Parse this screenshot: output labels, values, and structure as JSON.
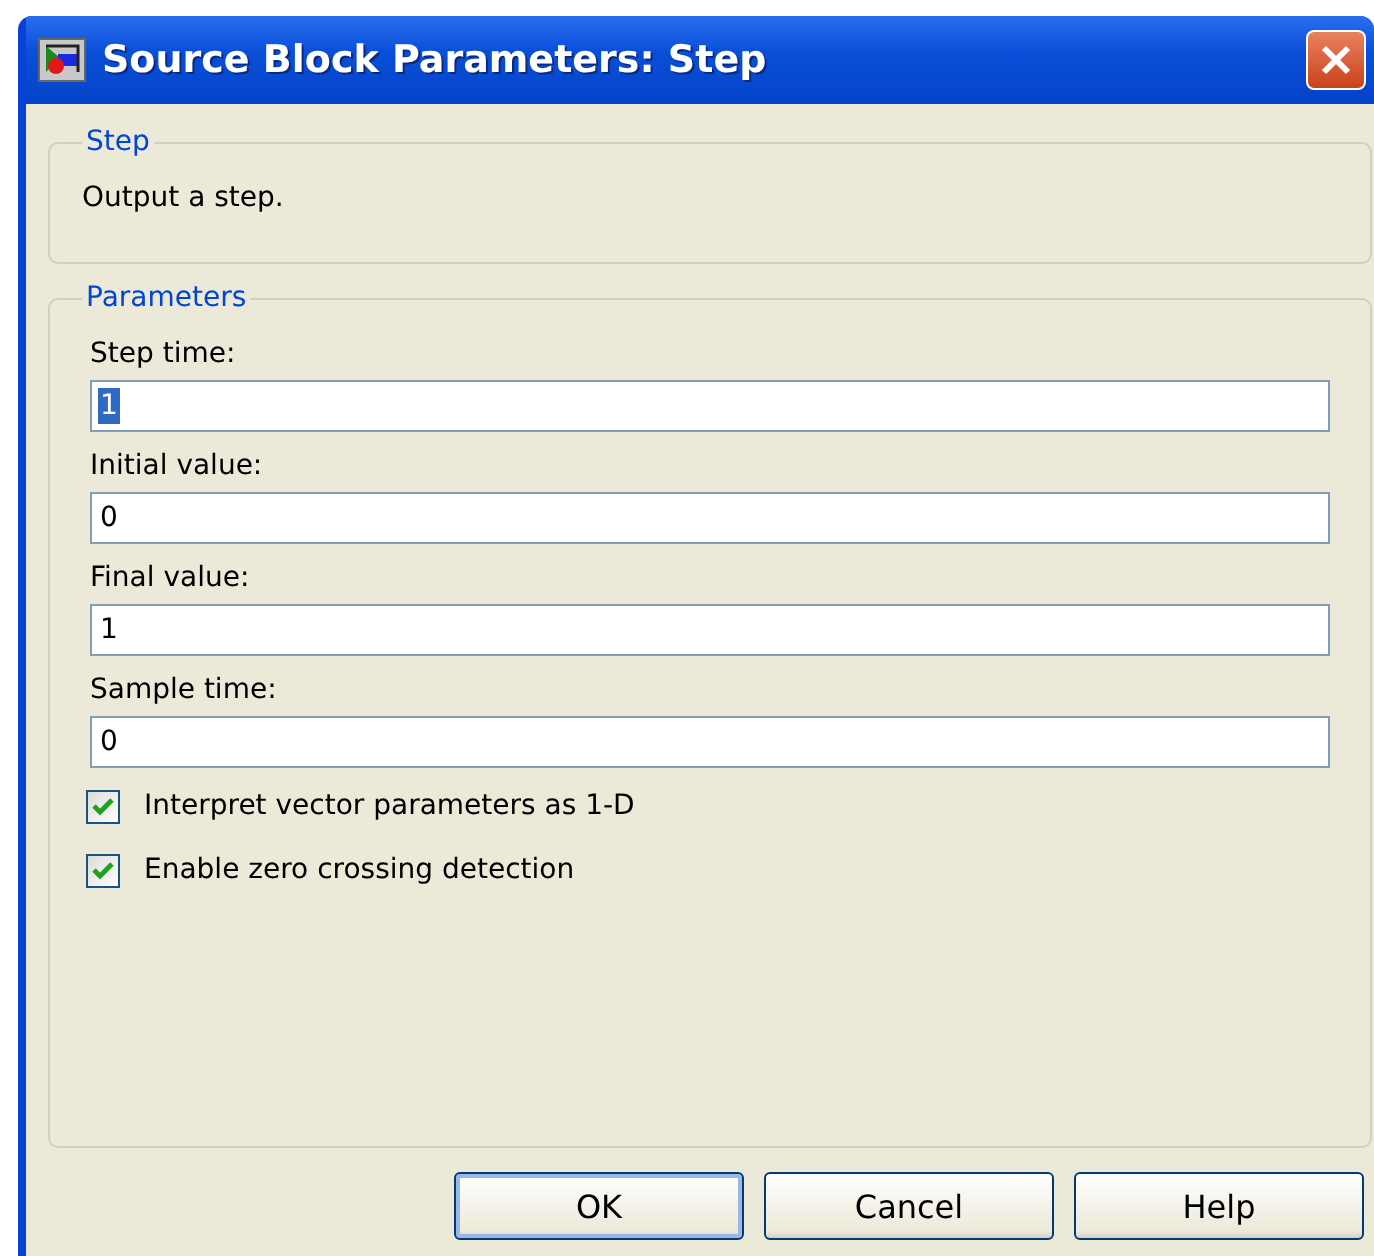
{
  "window": {
    "title": "Source Block Parameters: Step"
  },
  "description_group": {
    "title": "Step",
    "text": "Output a step."
  },
  "parameters_group": {
    "title": "Parameters",
    "fields": [
      {
        "label": "Step time:",
        "value": "1",
        "text_selected": true
      },
      {
        "label": "Initial value:",
        "value": "0",
        "text_selected": false
      },
      {
        "label": "Final value:",
        "value": "1",
        "text_selected": false
      },
      {
        "label": "Sample time:",
        "value": "0",
        "text_selected": false
      }
    ],
    "checkboxes": [
      {
        "label": "Interpret vector parameters as 1-D",
        "checked": true
      },
      {
        "label": "Enable zero crossing detection",
        "checked": true
      }
    ]
  },
  "buttons": [
    {
      "label": "OK",
      "default": true
    },
    {
      "label": "Cancel",
      "default": false
    },
    {
      "label": "Help",
      "default": false
    }
  ]
}
